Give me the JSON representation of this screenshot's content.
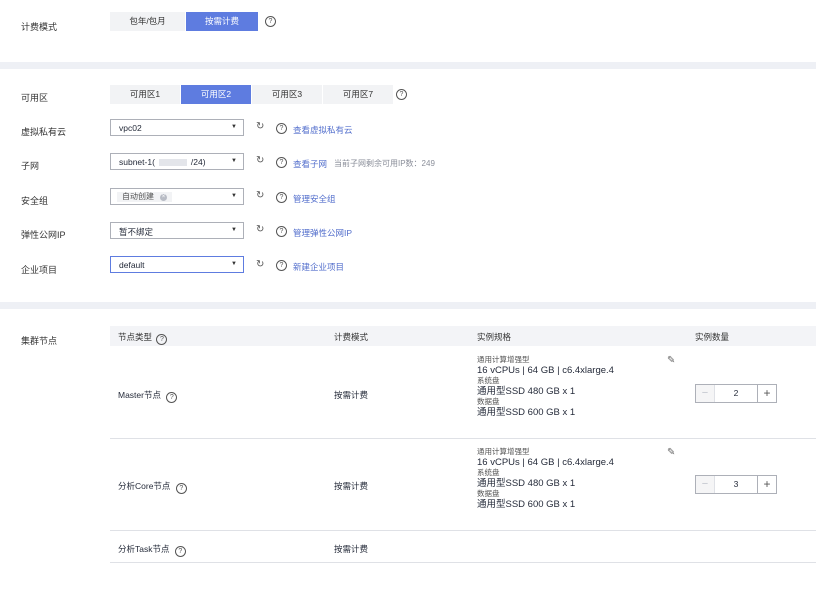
{
  "billing": {
    "label": "计费模式",
    "options": [
      "包年/包月",
      "按需计费"
    ],
    "selected": "按需计费"
  },
  "az": {
    "label": "可用区",
    "options": [
      "可用区1",
      "可用区2",
      "可用区3",
      "可用区7"
    ],
    "selected": "可用区2"
  },
  "vpc": {
    "label": "虚拟私有云",
    "value": "vpc02",
    "link": "查看虚拟私有云"
  },
  "subnet": {
    "label": "子网",
    "value": "subnet-1(",
    "value_suffix": "/24)",
    "link": "查看子网",
    "hint": "当前子网剩余可用IP数：249"
  },
  "security_group": {
    "label": "安全组",
    "tag": "自动创建",
    "link": "管理安全组"
  },
  "eip": {
    "label": "弹性公网IP",
    "value": "暂不绑定",
    "link": "管理弹性公网IP"
  },
  "enterprise_project": {
    "label": "企业项目",
    "value": "default",
    "link": "新建企业项目"
  },
  "cluster_nodes": {
    "label": "集群节点",
    "columns": [
      "节点类型",
      "计费模式",
      "实例规格",
      "实例数量"
    ],
    "rows": [
      {
        "type": "Master节点",
        "billing": "按需计费",
        "spec_type": "通用计算增强型",
        "spec": "16 vCPUs | 64 GB | c6.4xlarge.4",
        "sys_disk_label": "系统盘",
        "sys_disk": "通用型SSD 480 GB x 1",
        "data_disk_label": "数据盘",
        "data_disk": "通用型SSD 600 GB x 1",
        "count": "2"
      },
      {
        "type": "分析Core节点",
        "billing": "按需计费",
        "spec_type": "通用计算增强型",
        "spec": "16 vCPUs | 64 GB | c6.4xlarge.4",
        "sys_disk_label": "系统盘",
        "sys_disk": "通用型SSD 480 GB x 1",
        "data_disk_label": "数据盘",
        "data_disk": "通用型SSD 600 GB x 1",
        "count": "3"
      },
      {
        "type": "分析Task节点",
        "billing": "按需计费"
      }
    ]
  },
  "icons": {
    "help": "?",
    "refresh": "↻",
    "caret": "▼",
    "pencil": "✎",
    "minus": "−",
    "plus": "+"
  },
  "colors": {
    "accent": "#5e7ce0",
    "link": "#526ecc",
    "divider": "#eef0f5"
  }
}
